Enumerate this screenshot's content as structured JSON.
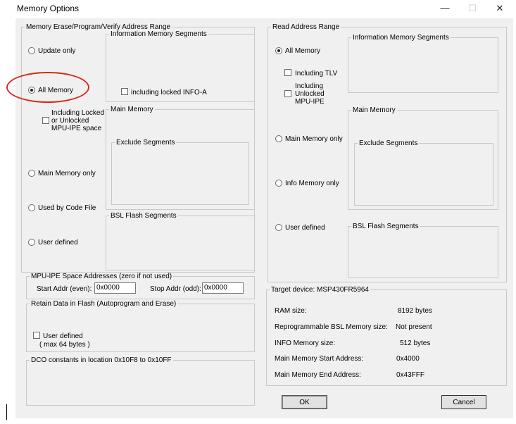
{
  "window": {
    "title": "Memory Options",
    "minimize_glyph": "—",
    "maximize_glyph": "☐",
    "close_glyph": "✕"
  },
  "erase_group": {
    "title": "Memory Erase/Program/Verify Address Range",
    "update_only": "Update only",
    "all_memory": "All Memory",
    "including_locked_mpu": "Including Locked or Unlocked MPU-IPE space",
    "main_memory_only": "Main Memory only",
    "used_by_code_file": "Used by Code File",
    "user_defined": "User defined",
    "info_segments_title": "Information Memory Segments",
    "including_locked_info_a": "including locked INFO-A",
    "main_memory_title": "Main Memory",
    "exclude_segments_title": "Exclude Segments",
    "bsl_flash_title": "BSL Flash Segments",
    "selected": "all_memory"
  },
  "mpu_group": {
    "title": "MPU-IPE Space Addresses (zero if not used)",
    "start_label": "Start Addr (even):",
    "start_value": "0x0000",
    "stop_label": "Stop Addr (odd):",
    "stop_value": "0x0000"
  },
  "retain_group": {
    "title": "Retain Data in Flash (Autoprogram and Erase)",
    "user_defined": "User defined",
    "max_note": "( max 64 bytes )"
  },
  "dco_group": {
    "title": "DCO constants in location 0x10F8 to 0x10FF"
  },
  "read_group": {
    "title": "Read Address Range",
    "all_memory": "All Memory",
    "including_tlv": "Including TLV",
    "including_mpu": "Including Unlocked MPU-IPE",
    "main_memory_only": "Main Memory only",
    "info_memory_only": "Info Memory only",
    "user_defined": "User defined",
    "info_segments_title": "Information Memory Segments",
    "main_memory_title": "Main Memory",
    "exclude_segments_title": "Exclude Segments",
    "bsl_flash_title": "BSL Flash Segments",
    "selected": "all_memory"
  },
  "target_group": {
    "title": "Target device:  MSP430FR5964",
    "rows": [
      {
        "label": "RAM size:",
        "value": "8192  bytes"
      },
      {
        "label": "Reprogrammable BSL Memory size:",
        "value": "Not present"
      },
      {
        "label": "INFO Memory size:",
        "value": "512  bytes"
      },
      {
        "label": "Main Memory Start Address:",
        "value": "0x4000"
      },
      {
        "label": "Main Memory End Address:",
        "value": "0x43FFF"
      }
    ]
  },
  "buttons": {
    "ok": "OK",
    "cancel": "Cancel"
  },
  "colors": {
    "annotation_circle": "#d8281e",
    "dialog_bg": "#f0f0f0"
  }
}
